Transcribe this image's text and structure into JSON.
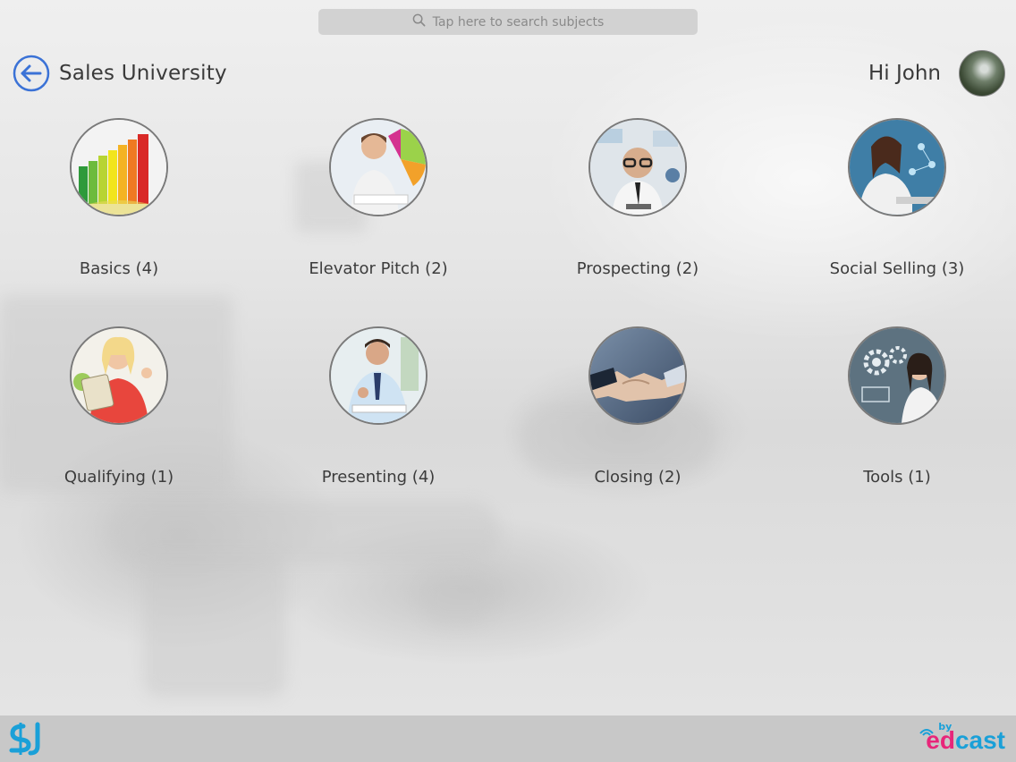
{
  "search": {
    "placeholder": "Tap here to search subjects",
    "icon": "search-icon"
  },
  "header": {
    "title": "Sales University",
    "back_icon": "back-arrow-icon",
    "greeting": "Hi John",
    "accent_color": "#3b72d6"
  },
  "subjects": [
    {
      "label": "Basics (4)",
      "image": "energy-rating-bars"
    },
    {
      "label": "Elevator Pitch (2)",
      "image": "woman-with-pie-chart"
    },
    {
      "label": "Prospecting (2)",
      "image": "man-with-glasses-data"
    },
    {
      "label": "Social Selling (3)",
      "image": "woman-on-laptop-network"
    },
    {
      "label": "Qualifying (1)",
      "image": "woman-with-tablet"
    },
    {
      "label": "Presenting (4)",
      "image": "man-thumbs-up"
    },
    {
      "label": "Closing (2)",
      "image": "handshake"
    },
    {
      "label": "Tools (1)",
      "image": "woman-with-gears"
    }
  ],
  "footer": {
    "left_logo": "SJ",
    "right_logo_by": "by",
    "right_logo_ed": "ed",
    "right_logo_cast": "cast",
    "ed_color": "#e8267a",
    "cast_color": "#1aa0d8"
  }
}
